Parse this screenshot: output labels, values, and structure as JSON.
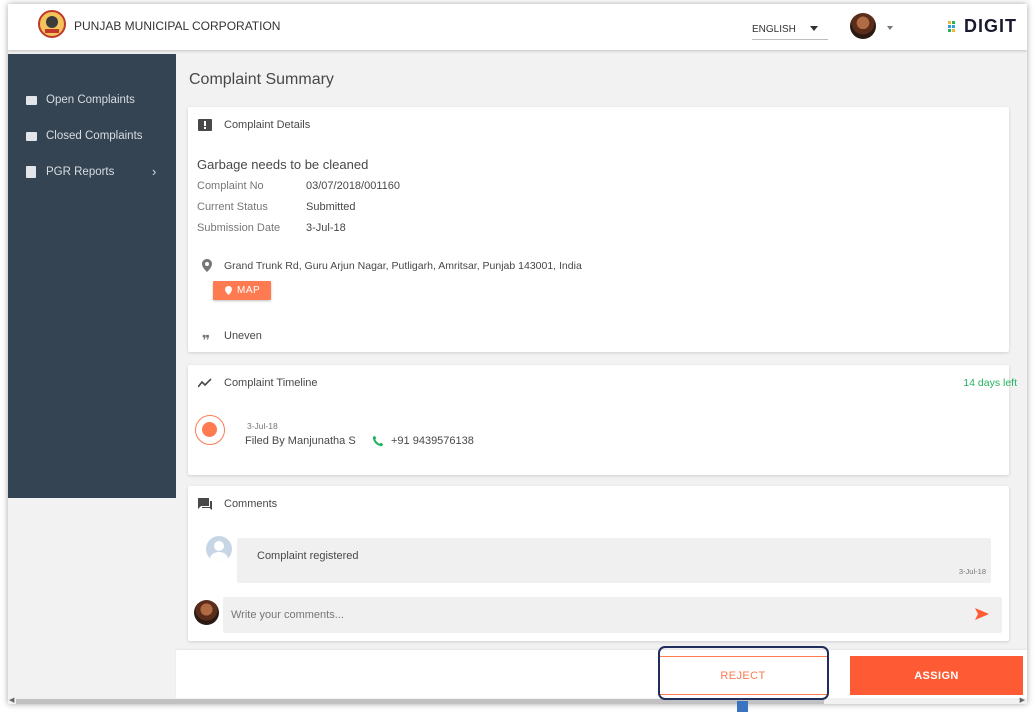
{
  "header": {
    "org_name": "PUNJAB MUNICIPAL CORPORATION",
    "language": "ENGLISH",
    "brand": "DIGIT"
  },
  "sidebar": {
    "items": [
      {
        "label": "Open Complaints"
      },
      {
        "label": "Closed Complaints"
      },
      {
        "label": "PGR Reports"
      }
    ]
  },
  "page": {
    "title": "Complaint Summary"
  },
  "details": {
    "heading": "Complaint Details",
    "complaint_title": "Garbage needs to be cleaned",
    "rows": [
      {
        "label": "Complaint No",
        "value": "03/07/2018/001160"
      },
      {
        "label": "Current Status",
        "value": "Submitted"
      },
      {
        "label": "Submission Date",
        "value": "3-Jul-18"
      }
    ],
    "address": "Grand Trunk Rd, Guru Arjun Nagar, Putligarh, Amritsar, Punjab 143001, India",
    "map_label": "MAP",
    "comment": "Uneven"
  },
  "timeline": {
    "heading": "Complaint Timeline",
    "days_left": "14 days left",
    "date": "3-Jul-18",
    "filed_by": "Filed By Manjunatha S",
    "phone": "+91 9439576138"
  },
  "comments": {
    "heading": "Comments",
    "items": [
      {
        "text": "Complaint registered",
        "date": "3-Jul-18"
      }
    ],
    "input_placeholder": "Write your comments..."
  },
  "actions": {
    "reject": "REJECT",
    "assign": "ASSIGN"
  },
  "colors": {
    "accent": "#fe7a51",
    "sidebar": "#354452",
    "success": "#22b25f"
  },
  "icons": [
    "emblem-logo",
    "digit-logo",
    "folder-icon",
    "report-icon",
    "chevron-right-icon",
    "comment-alert-icon",
    "location-icon",
    "quote-icon",
    "timeline-icon",
    "phone-icon",
    "chat-icon",
    "send-icon"
  ]
}
